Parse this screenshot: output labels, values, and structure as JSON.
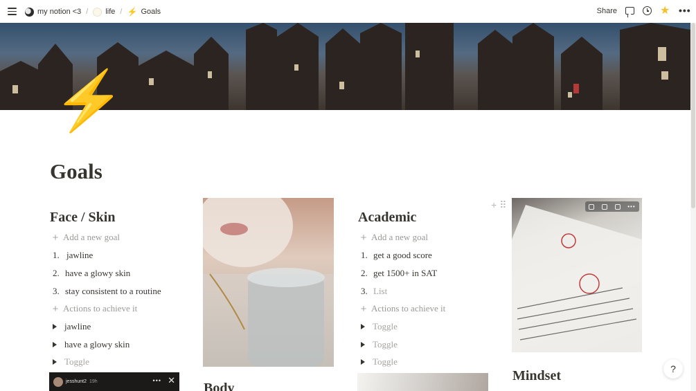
{
  "topbar": {
    "breadcrumbs": [
      {
        "label": "my notion <3",
        "icon": "moon-icon"
      },
      {
        "label": "life",
        "icon": "sun-icon"
      },
      {
        "label": "Goals",
        "icon": "lightning-icon"
      }
    ],
    "separator": "/",
    "share_label": "Share",
    "star_color": "#f6c02b",
    "icons": [
      "menu-icon",
      "comment-icon",
      "clock-icon",
      "star-icon",
      "more-icon"
    ]
  },
  "page": {
    "icon": "⚡",
    "title": "Goals"
  },
  "face_skin": {
    "heading": "Face / Skin",
    "add_goal": "Add a new goal",
    "goals": [
      {
        "num": "1.",
        "text": "jawline"
      },
      {
        "num": "2.",
        "text": "have a glowy skin"
      },
      {
        "num": "3.",
        "text": "stay consistent to a routine"
      }
    ],
    "actions_label": "Actions to achieve it",
    "toggles": [
      "jawline",
      "have a glowy skin",
      "Toggle"
    ]
  },
  "body_section": {
    "heading": "Body"
  },
  "academic": {
    "heading": "Academic",
    "add_goal": "Add a new goal",
    "goals": [
      {
        "num": "1.",
        "text": "get a good score"
      },
      {
        "num": "2.",
        "text": "get 1500+ in SAT"
      },
      {
        "num": "3.",
        "text": "List"
      }
    ],
    "actions_label": "Actions to achieve it",
    "toggles": [
      "Toggle",
      "Toggle",
      "Toggle"
    ]
  },
  "mindset": {
    "heading": "Mindset"
  },
  "story": {
    "username": "jesshunt2",
    "time": "19h"
  },
  "help_label": "?"
}
